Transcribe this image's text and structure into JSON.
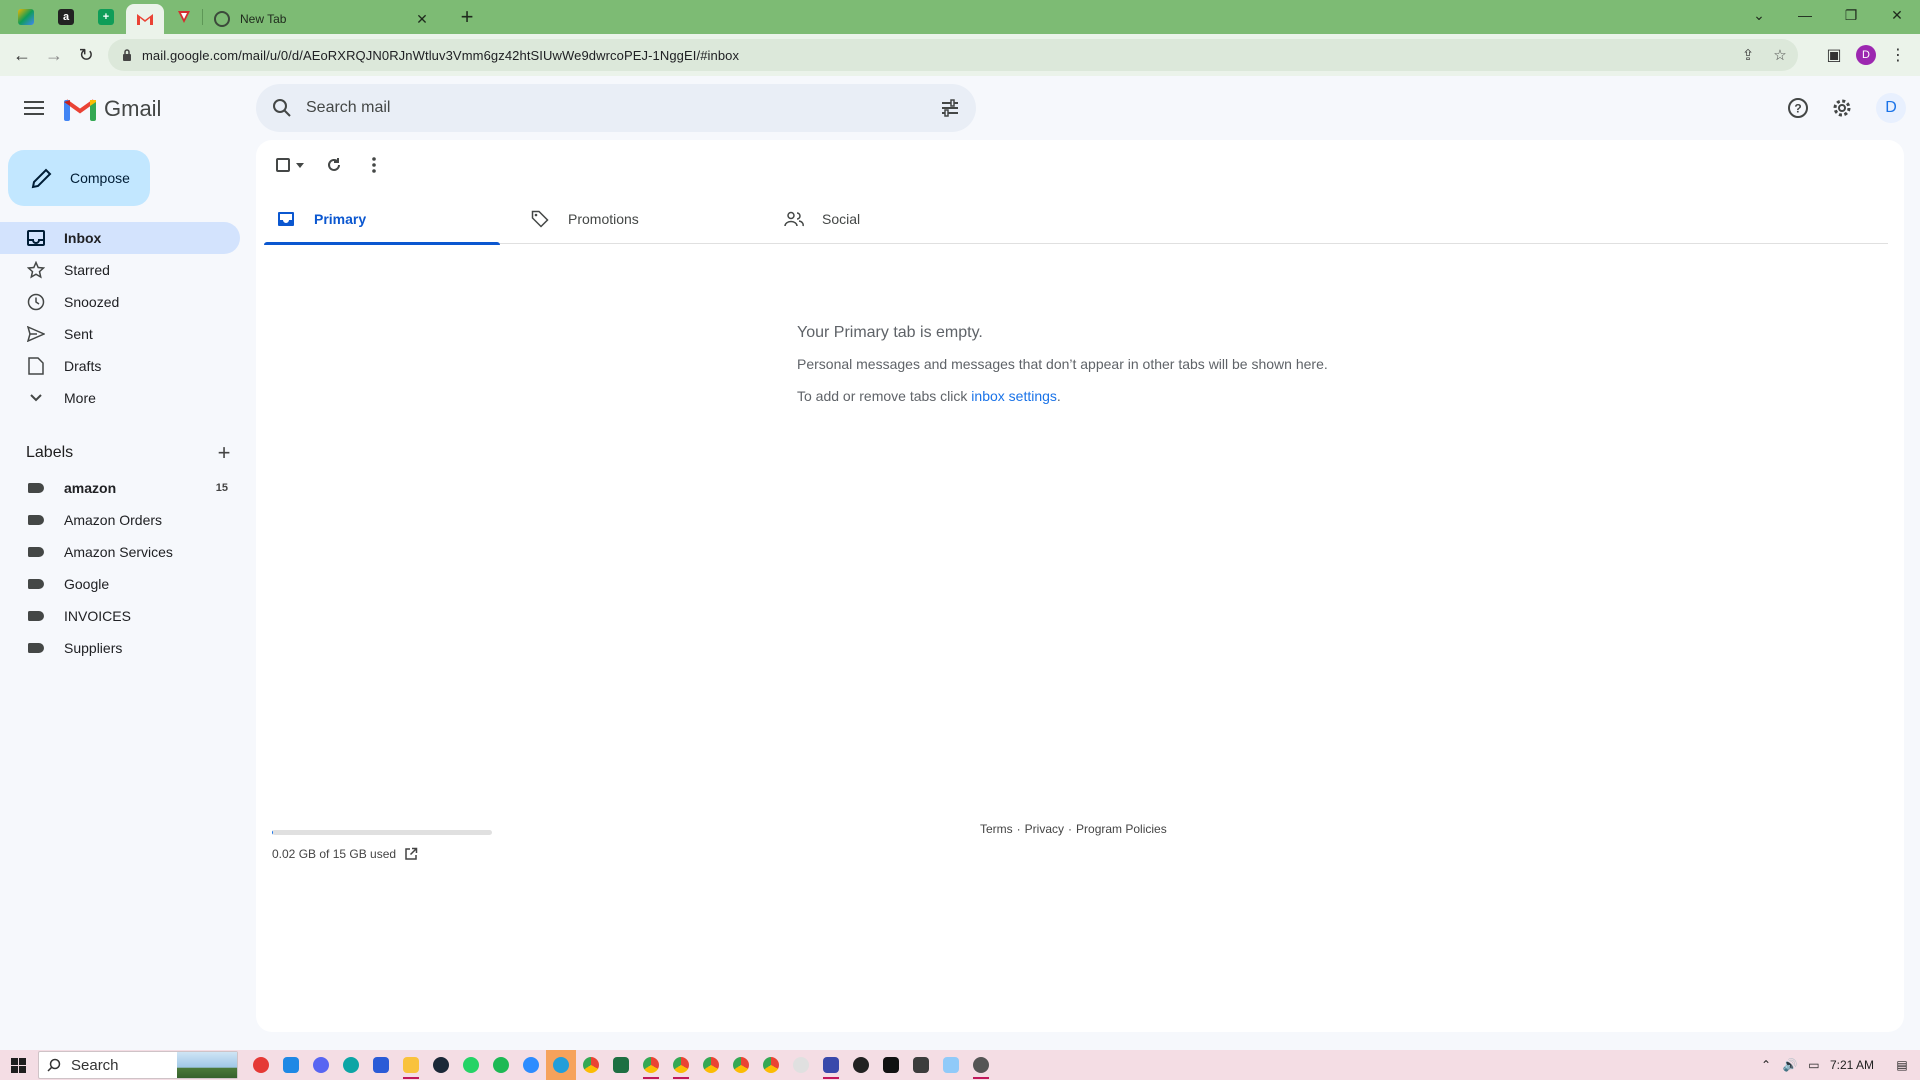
{
  "browser": {
    "tab_title": "New Tab",
    "url": "mail.google.com/mail/u/0/d/AEoRXRQJN0RJnWtluv3Vmm6gz42htSIUwWe9dwrcoPEJ-1NggEI/#inbox",
    "profile_initial": "D",
    "accent": "#7dbb74"
  },
  "gmail": {
    "logo_text": "Gmail",
    "search_placeholder": "Search mail",
    "account_initial": "D",
    "compose_label": "Compose",
    "nav": [
      {
        "label": "Inbox",
        "icon": "inbox-icon",
        "active": true
      },
      {
        "label": "Starred",
        "icon": "star-icon"
      },
      {
        "label": "Snoozed",
        "icon": "clock-icon"
      },
      {
        "label": "Sent",
        "icon": "send-icon"
      },
      {
        "label": "Drafts",
        "icon": "draft-icon"
      },
      {
        "label": "More",
        "icon": "chevron-down-icon"
      }
    ],
    "labels_title": "Labels",
    "labels": [
      {
        "name": "amazon",
        "count": "15",
        "bold": true
      },
      {
        "name": "Amazon Orders"
      },
      {
        "name": "Amazon Services"
      },
      {
        "name": "Google"
      },
      {
        "name": "INVOICES"
      },
      {
        "name": "Suppliers"
      }
    ],
    "tabs": [
      {
        "label": "Primary",
        "active": true
      },
      {
        "label": "Promotions"
      },
      {
        "label": "Social"
      }
    ],
    "empty": {
      "heading": "Your Primary tab is empty.",
      "line1": "Personal messages and messages that don’t appear in other tabs will be shown here.",
      "line2_prefix": "To add or remove tabs click ",
      "line2_link": "inbox settings",
      "line2_suffix": "."
    },
    "storage": {
      "text": "0.02 GB of 15 GB used",
      "fraction": 0.0013
    },
    "footer": {
      "terms": "Terms",
      "sep": "·",
      "privacy": "Privacy",
      "policies": "Program Policies"
    }
  },
  "taskbar": {
    "search_label": "Search",
    "time": "7:21 AM"
  }
}
